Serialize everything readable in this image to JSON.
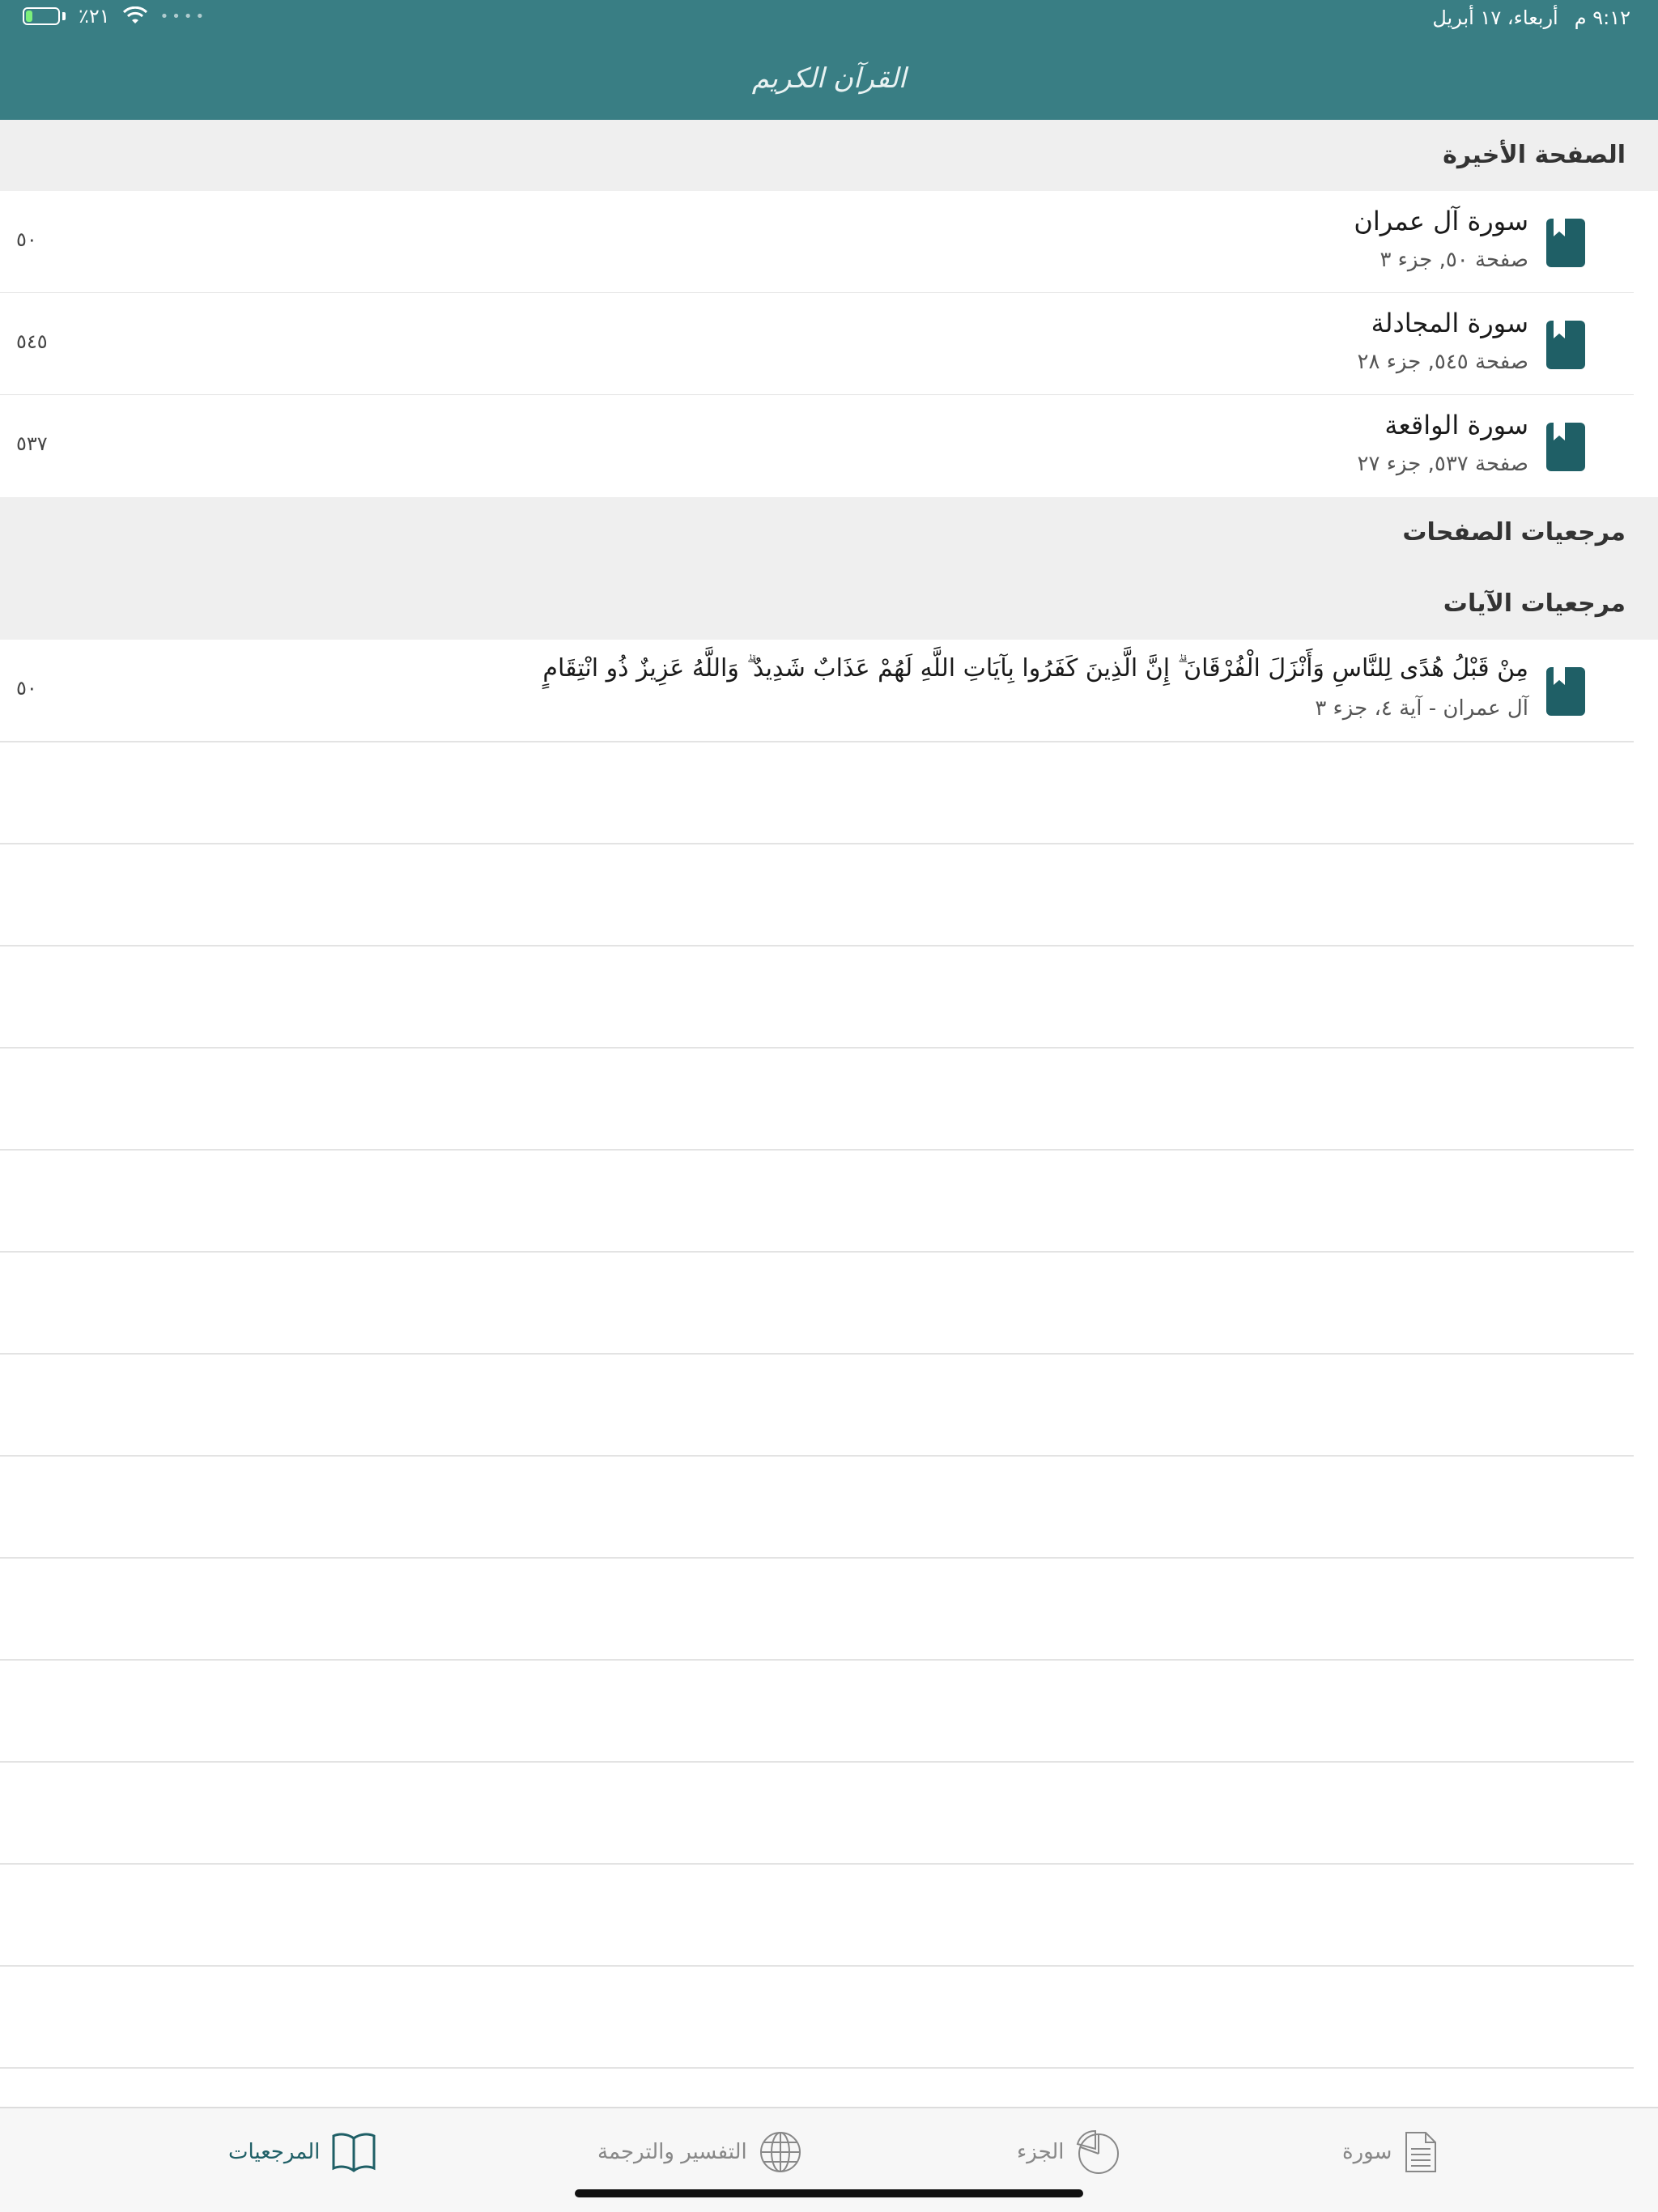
{
  "status_bar": {
    "time": "٩:١٢ م",
    "date": "أربعاء، ١٧ أبريل",
    "battery": "٪٢١",
    "battery_level": 0.21
  },
  "header": {
    "logo_text": "القرآن الكريم"
  },
  "sections": {
    "last_page": "الصفحة الأخيرة",
    "page_bookmarks": "مرجعيات الصفحات",
    "ayah_bookmarks": "مرجعيات الآيات"
  },
  "last_pages": [
    {
      "title": "سورة آل عمران",
      "subtitle": "صفحة ٥٠, جزء ٣",
      "page": "٥٠"
    },
    {
      "title": "سورة المجادلة",
      "subtitle": "صفحة ٥٤٥, جزء ٢٨",
      "page": "٥٤٥"
    },
    {
      "title": "سورة الواقعة",
      "subtitle": "صفحة ٥٣٧, جزء ٢٧",
      "page": "٥٣٧"
    }
  ],
  "ayah_bookmarks": [
    {
      "text": "مِنْ قَبْلُ هُدًى لِلنَّاسِ وَأَنْزَلَ الْفُرْقَانَ ۗ إِنَّ الَّذِينَ كَفَرُوا بِآيَاتِ اللَّهِ لَهُمْ عَذَابٌ شَدِيدٌ ۗ وَاللَّهُ عَزِيزٌ ذُو انْتِقَامٍ",
      "subtitle": "آل عمران - آية ٤، جزء ٣",
      "page": "٥٠"
    }
  ],
  "tabs": [
    {
      "label": "سورة",
      "icon": "document-icon"
    },
    {
      "label": "الجزء",
      "icon": "pie-icon"
    },
    {
      "label": "التفسير والترجمة",
      "icon": "globe-icon"
    },
    {
      "label": "المرجعيات",
      "icon": "book-icon",
      "active": true
    }
  ],
  "colors": {
    "header": "#397e84",
    "accent": "#1f5f66",
    "section_bg": "#efefef"
  }
}
